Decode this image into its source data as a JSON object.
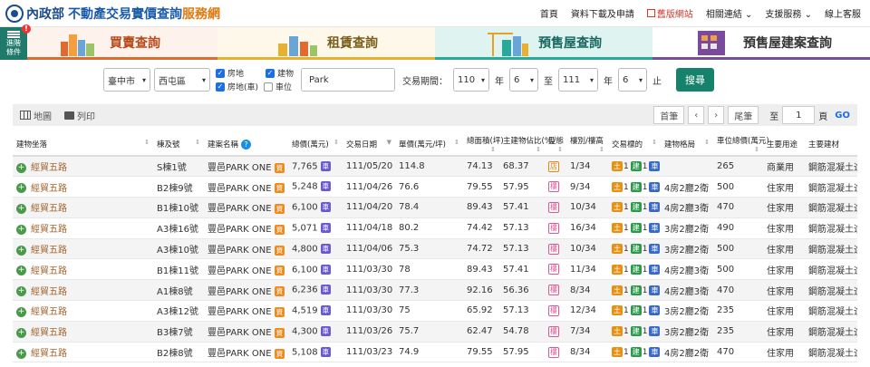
{
  "header": {
    "ministry": "內政部",
    "title_main": "不動產交易實價查詢",
    "title_accent": "服務網",
    "nav": [
      {
        "label": "首頁"
      },
      {
        "label": "資料下載及申請"
      },
      {
        "label": "舊版網站",
        "old": true
      },
      {
        "label": "相關連結",
        "drop": true
      },
      {
        "label": "支援服務",
        "drop": true
      },
      {
        "label": "線上客服"
      }
    ]
  },
  "adv": {
    "line1": "進階",
    "line2": "條件",
    "badge": "!"
  },
  "tabs": [
    {
      "label": "買賣查詢"
    },
    {
      "label": "租賃查詢"
    },
    {
      "label": "預售屋查詢"
    },
    {
      "label": "預售屋建案查詢"
    }
  ],
  "filters": {
    "city": "臺中市",
    "district": "西屯區",
    "checks": [
      {
        "label": "房地",
        "checked": true
      },
      {
        "label": "建物",
        "checked": true
      },
      {
        "label": "房地(車)",
        "checked": true
      },
      {
        "label": "車位",
        "checked": false
      }
    ],
    "keyword": "Park",
    "period_label": "交易期間：",
    "from_year": "110",
    "year_unit1": "年",
    "from_month": "6",
    "to": "至",
    "to_year": "111",
    "year_unit2": "年",
    "to_month": "6",
    "end": "止",
    "search": "搜尋"
  },
  "toolbar": {
    "map": "地圖",
    "print": "列印",
    "first": "首筆",
    "prev": "‹",
    "next": "›",
    "last": "尾筆",
    "to": "至",
    "page": "1",
    "page_unit": "頁",
    "go": "GO"
  },
  "columns": [
    "建物坐落",
    "棟及號",
    "建案名稱",
    "總價(萬元)",
    "交易日期",
    "單價(萬元/坪)",
    "總面積(坪)",
    "主建物佔比(%)",
    "型態",
    "樓別/樓高",
    "交易標的",
    "建物格局",
    "車位總價(萬元)",
    "主要用途",
    "主要建材"
  ],
  "colors": {
    "green": "#17826b",
    "orange": "#f08a1c",
    "blue": "#1c6fe3"
  },
  "rows": [
    {
      "addr": "經貿五路",
      "unit": "S棟1號",
      "project": "豐邑PARK ONE",
      "total": "7,765",
      "date": "111/05/20",
      "price": "114.8",
      "area": "74.13",
      "ratio": "68.37",
      "type": "店",
      "floor": "1/34",
      "t1": "1",
      "t2": "1",
      "t3": "1",
      "layout": "",
      "park": "265",
      "use": "商業用",
      "mat": "鋼筋混凝土造"
    },
    {
      "addr": "經貿五路",
      "unit": "B2棟9號",
      "project": "豐邑PARK ONE",
      "total": "5,248",
      "date": "111/04/26",
      "price": "76.6",
      "area": "79.55",
      "ratio": "57.95",
      "type": "樓",
      "floor": "9/34",
      "t1": "1",
      "t2": "1",
      "t3": "2",
      "layout": "4房2廳2衛",
      "park": "500",
      "use": "住家用",
      "mat": "鋼筋混凝土造"
    },
    {
      "addr": "經貿五路",
      "unit": "B1棟10號",
      "project": "豐邑PARK ONE",
      "total": "6,100",
      "date": "111/04/20",
      "price": "78.4",
      "area": "89.43",
      "ratio": "57.41",
      "type": "樓",
      "floor": "10/34",
      "t1": "1",
      "t2": "1",
      "t3": "2",
      "layout": "4房2廳3衛",
      "park": "470",
      "use": "住家用",
      "mat": "鋼筋混凝土造"
    },
    {
      "addr": "經貿五路",
      "unit": "A3棟16號",
      "project": "豐邑PARK ONE",
      "total": "5,071",
      "date": "111/04/18",
      "price": "80.2",
      "area": "74.42",
      "ratio": "57.13",
      "type": "樓",
      "floor": "16/34",
      "t1": "1",
      "t2": "1",
      "t3": "2",
      "layout": "3房2廳2衛",
      "park": "490",
      "use": "住家用",
      "mat": "鋼筋混凝土造"
    },
    {
      "addr": "經貿五路",
      "unit": "A3棟10號",
      "project": "豐邑PARK ONE",
      "total": "4,800",
      "date": "111/04/06",
      "price": "75.3",
      "area": "74.72",
      "ratio": "57.13",
      "type": "樓",
      "floor": "10/34",
      "t1": "1",
      "t2": "1",
      "t3": "2",
      "layout": "3房2廳2衛",
      "park": "500",
      "use": "住家用",
      "mat": "鋼筋混凝土造"
    },
    {
      "addr": "經貿五路",
      "unit": "B1棟11號",
      "project": "豐邑PARK ONE",
      "total": "6,100",
      "date": "111/03/30",
      "price": "78",
      "area": "89.43",
      "ratio": "57.41",
      "type": "樓",
      "floor": "11/34",
      "t1": "1",
      "t2": "1",
      "t3": "2",
      "layout": "4房2廳3衛",
      "park": "500",
      "use": "住家用",
      "mat": "鋼筋混凝土造"
    },
    {
      "addr": "經貿五路",
      "unit": "A1棟8號",
      "project": "豐邑PARK ONE",
      "total": "6,236",
      "date": "111/03/30",
      "price": "77.3",
      "area": "92.16",
      "ratio": "56.36",
      "type": "樓",
      "floor": "8/34",
      "t1": "1",
      "t2": "1",
      "t3": "2",
      "layout": "4房2廳3衛",
      "park": "470",
      "use": "住家用",
      "mat": "鋼筋混凝土造"
    },
    {
      "addr": "經貿五路",
      "unit": "A3棟12號",
      "project": "豐邑PARK ONE",
      "total": "4,519",
      "date": "111/03/30",
      "price": "75",
      "area": "65.92",
      "ratio": "57.13",
      "type": "樓",
      "floor": "12/34",
      "t1": "1",
      "t2": "1",
      "t3": "1",
      "layout": "3房2廳2衛",
      "park": "235",
      "use": "住家用",
      "mat": "鋼筋混凝土造"
    },
    {
      "addr": "經貿五路",
      "unit": "B3棟7號",
      "project": "豐邑PARK ONE",
      "total": "4,300",
      "date": "111/03/26",
      "price": "75.7",
      "area": "62.47",
      "ratio": "54.78",
      "type": "樓",
      "floor": "7/34",
      "t1": "1",
      "t2": "1",
      "t3": "1",
      "layout": "3房2廳2衛",
      "park": "235",
      "use": "住家用",
      "mat": "鋼筋混凝土造"
    },
    {
      "addr": "經貿五路",
      "unit": "B2棟8號",
      "project": "豐邑PARK ONE",
      "total": "5,108",
      "date": "111/03/23",
      "price": "74.9",
      "area": "79.55",
      "ratio": "57.95",
      "type": "樓",
      "floor": "8/34",
      "t1": "1",
      "t2": "1",
      "t3": "2",
      "layout": "4房2廳2衛",
      "park": "470",
      "use": "住家用",
      "mat": "鋼筋混凝土造"
    }
  ]
}
